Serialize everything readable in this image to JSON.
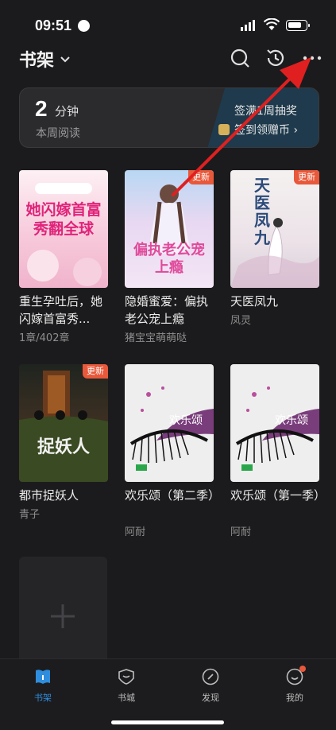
{
  "status": {
    "time": "09:51"
  },
  "header": {
    "title": "书架"
  },
  "reading": {
    "minutes": "2",
    "unit": "分钟",
    "label": "本周阅读",
    "sign_top": "签满1周抽奖",
    "sign_bottom": "签到领赠币 ›"
  },
  "books": [
    {
      "title": "重生孕吐后，她闪嫁首富秀...",
      "sub": "1章/402章",
      "badge": "",
      "cover_text": "她闪嫁首富秀翻全球"
    },
    {
      "title": "隐婚蜜爱：偏执老公宠上瘾",
      "sub": "猪宝宝萌萌哒",
      "badge": "更新",
      "cover_text": "偏执老公宠上瘾"
    },
    {
      "title": "天医凤九",
      "sub": "凤灵",
      "badge": "更新",
      "cover_text": "天医凤九"
    },
    {
      "title": "都市捉妖人",
      "sub": "青子",
      "badge": "更新",
      "cover_text": "捉妖人"
    },
    {
      "title": "欢乐颂（第二季）",
      "sub": "阿耐",
      "badge": "",
      "cover_text": "欢乐颂"
    },
    {
      "title": "欢乐颂（第一季）",
      "sub": "阿耐",
      "badge": "",
      "cover_text": "欢乐颂"
    }
  ],
  "tabs": [
    {
      "label": "书架",
      "icon": "bookshelf-icon"
    },
    {
      "label": "书城",
      "icon": "bookstore-icon"
    },
    {
      "label": "发现",
      "icon": "compass-icon"
    },
    {
      "label": "我的",
      "icon": "profile-icon"
    }
  ],
  "colors": {
    "accent": "#2f8dde",
    "badge": "#e8583a",
    "annotation_arrow": "#e02020"
  }
}
